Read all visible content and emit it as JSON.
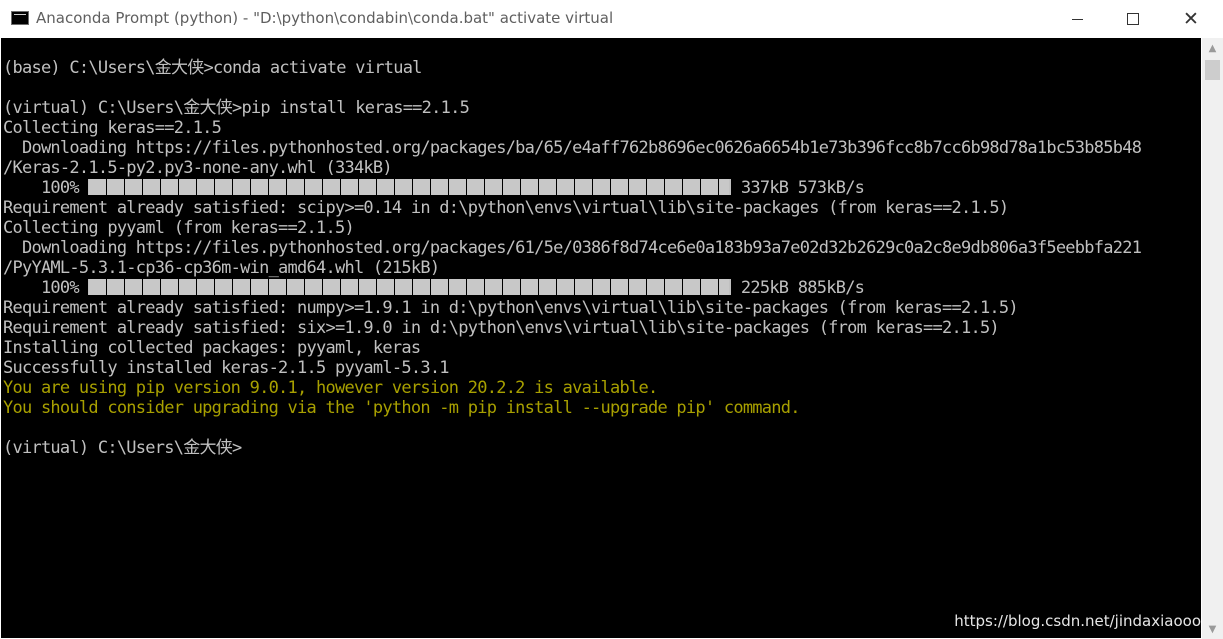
{
  "window": {
    "title": "Anaconda Prompt (python) - \"D:\\python\\condabin\\conda.bat\"  activate virtual",
    "minimize_icon": "minimize-icon",
    "maximize_icon": "maximize-icon",
    "close_icon": "close-icon"
  },
  "console": {
    "lines": [
      "",
      "(base) C:\\Users\\金大侠>conda activate virtual",
      "",
      "(virtual) C:\\Users\\金大侠>pip install keras==2.1.5",
      "Collecting keras==2.1.5",
      "  Downloading https://files.pythonhosted.org/packages/ba/65/e4aff762b8696ec0626a6654b1e73b396fcc8b7cc6b98d78a1bc53b85b48",
      "/Keras-2.1.5-py2.py3-none-any.whl (334kB)",
      "",
      "Requirement already satisfied: scipy>=0.14 in d:\\python\\envs\\virtual\\lib\\site-packages (from keras==2.1.5)",
      "Collecting pyyaml (from keras==2.1.5)",
      "  Downloading https://files.pythonhosted.org/packages/61/5e/0386f8d74ce6e0a183b93a7e02d32b2629c0a2c8e9db806a3f5eebbfa221",
      "/PyYAML-5.3.1-cp36-cp36m-win_amd64.whl (215kB)",
      "",
      "Requirement already satisfied: numpy>=1.9.1 in d:\\python\\envs\\virtual\\lib\\site-packages (from keras==2.1.5)",
      "Requirement already satisfied: six>=1.9.0 in d:\\python\\envs\\virtual\\lib\\site-packages (from keras==2.1.5)",
      "Installing collected packages: pyyaml, keras",
      "Successfully installed keras-2.1.5 pyyaml-5.3.1",
      "You are using pip version 9.0.1, however version 20.2.2 is available.",
      "You should consider upgrading via the 'python -m pip install --upgrade pip' command.",
      "",
      "(virtual) C:\\Users\\金大侠>"
    ],
    "progress": [
      {
        "percent_label": "    100% ",
        "fraction": 1.0,
        "stats": " 337kB 573kB/s"
      },
      {
        "percent_label": "    100% ",
        "fraction": 1.0,
        "stats": " 225kB 885kB/s"
      }
    ],
    "text_color": "#c0c0c0",
    "warning_color": "#a8a000",
    "background": "#000000"
  },
  "watermark": "https://blog.csdn.net/jindaxiaooo"
}
